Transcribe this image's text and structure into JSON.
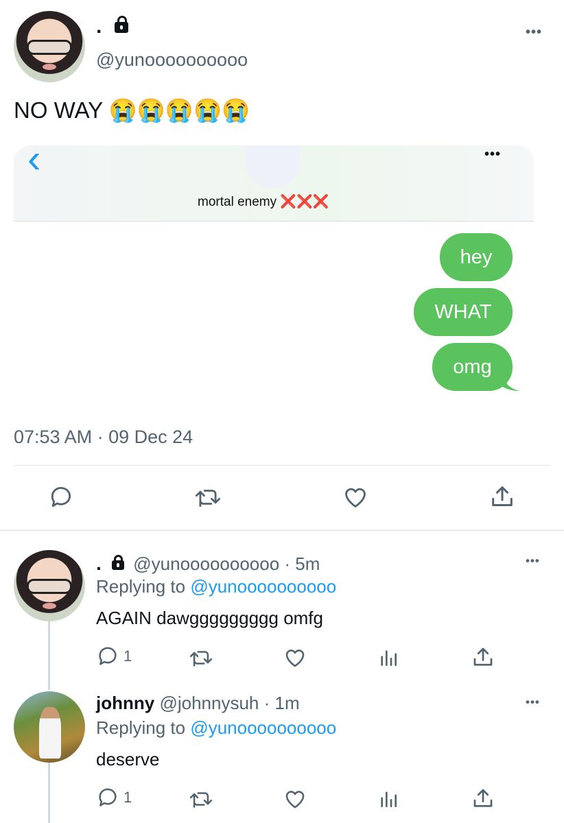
{
  "tweet": {
    "display_name": ".",
    "handle": "@yunoooooooooo",
    "text": "NO WAY 😭😭😭😭😭",
    "timestamp": "07:53 AM · 09 Dec 24",
    "more_label": "•••"
  },
  "screenshot": {
    "back_icon": "‹",
    "more_label": "•••",
    "contact_name": "mortal enemy ❌❌❌",
    "messages": [
      "hey",
      "WHAT",
      "omg"
    ],
    "bubble_color": "#5ac35d"
  },
  "replies": [
    {
      "display_name": ".",
      "handle": "@yunoooooooooo",
      "time": "· 5m",
      "replying_label": "Replying to",
      "replying_handle": "@yunoooooooooo",
      "text": "AGAIN dawggggggggg omfg",
      "reply_count": "1",
      "more_label": "•••"
    },
    {
      "display_name": "johnny",
      "handle": "@johnnysuh",
      "time": "· 1m",
      "replying_label": "Replying to",
      "replying_handle": "@yunoooooooooo",
      "text": "deserve",
      "reply_count": "1",
      "more_label": "•••"
    }
  ],
  "colors": {
    "accent": "#1d9bf0",
    "text": "#0f1419",
    "muted": "#536471"
  }
}
